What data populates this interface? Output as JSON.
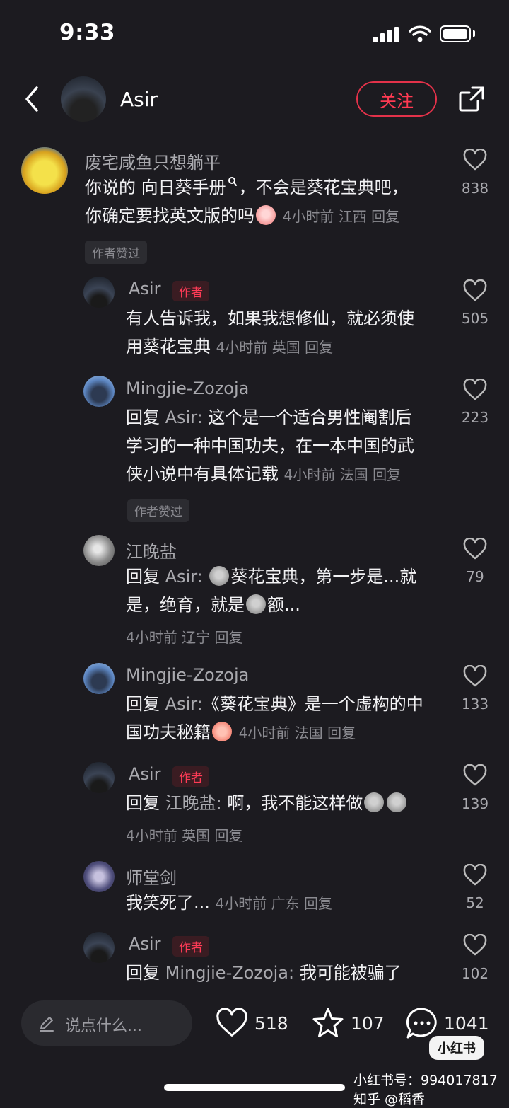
{
  "status": {
    "time": "9:33"
  },
  "header": {
    "username": "Asir",
    "follow_label": "关注"
  },
  "top_comment": {
    "name": "废宅咸鱼只想躺平",
    "text_a": "你说的 ",
    "search_term": "向日葵手册",
    "text_b": "，不会是葵花宝典吧，",
    "line2": "你确定要找英文版的吗",
    "meta": "4小时前  江西  回复",
    "likes": "838",
    "badge": "作者赞过"
  },
  "replies": [
    {
      "name": "Asir",
      "tag": "作者",
      "line1": "有人告诉我，如果我想修仙，就必须使",
      "line2": "用葵花宝典",
      "meta": "4小时前  英国  回复",
      "likes": "505"
    },
    {
      "name": "Mingjie-Zozoja",
      "reply_prefix": "回复",
      "reply_to": "Asir:",
      "line1": "这个是一个适合男性阉割后",
      "line2": "学习的一种中国功夫，在一本中国的武",
      "line3": "侠小说中有具体记载",
      "meta": "4小时前  法国  回复",
      "likes": "223",
      "badge": "作者赞过"
    },
    {
      "name": "江晚盐",
      "reply_prefix": "回复",
      "reply_to": "Asir:",
      "line1": "葵花宝典，第一步是...就",
      "line2a": "是，绝育，就是",
      "line2b": "额...",
      "meta": "4小时前  辽宁  回复",
      "likes": "79"
    },
    {
      "name": "Mingjie-Zozoja",
      "reply_prefix": "回复",
      "reply_to": "Asir:",
      "line1": "《葵花宝典》是一个虚构的中",
      "line2": "国功夫秘籍",
      "meta": "4小时前  法国  回复",
      "likes": "133"
    },
    {
      "name": "Asir",
      "tag": "作者",
      "reply_prefix": "回复",
      "reply_to": "江晚盐:",
      "line1": "啊，我不能这样做",
      "meta": "4小时前  英国  回复",
      "likes": "139"
    },
    {
      "name": "师堂剑",
      "line1": "我笑死了...",
      "meta": "4小时前  广东  回复",
      "likes": "52"
    },
    {
      "name": "Asir",
      "tag": "作者",
      "reply_prefix": "回复",
      "reply_to": "Mingjie-Zozoja:",
      "line1": "我可能被骗了",
      "likes": "102"
    }
  ],
  "bottom": {
    "input_placeholder": "说点什么...",
    "like_count": "518",
    "star_count": "107",
    "comment_count": "1041"
  },
  "watermark": {
    "logo": "小红书",
    "text": "小红书号：994017817 知乎 @稻香"
  }
}
